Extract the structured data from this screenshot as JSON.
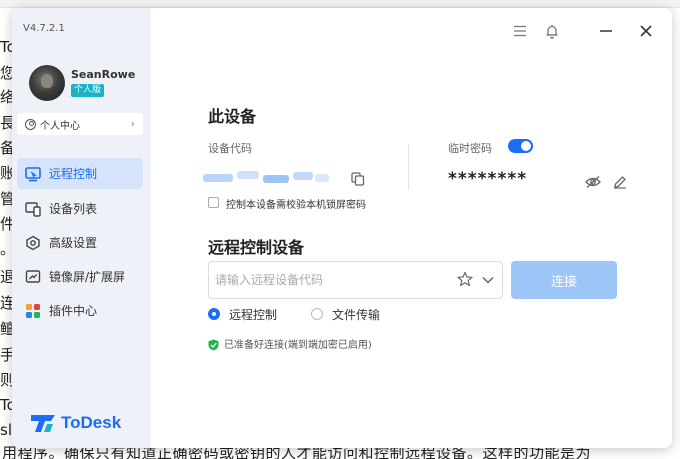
{
  "background_doc": {
    "left_chars": [
      "To",
      "您",
      "络",
      "長",
      "备",
      "账",
      "管",
      "件",
      "。",
      "退",
      "连",
      "鳣",
      "手",
      "则",
      "To",
      "sl"
    ],
    "bottom_line": "用程序。确保只有知道正确密码或密钥的人才能访问和控制远程设备。这样的功能是为"
  },
  "app": {
    "version": "V4.7.2.1",
    "user": {
      "name": "SeanRowe",
      "badge": "个人版"
    },
    "profile_center": "个人中心",
    "nav": [
      {
        "label": "远程控制",
        "icon": "remote-control-icon",
        "active": true
      },
      {
        "label": "设备列表",
        "icon": "device-list-icon",
        "active": false
      },
      {
        "label": "高级设置",
        "icon": "advanced-settings-icon",
        "active": false
      },
      {
        "label": "镜像屏/扩展屏",
        "icon": "mirror-screen-icon",
        "active": false
      },
      {
        "label": "插件中心",
        "icon": "plugin-center-icon",
        "active": false
      }
    ],
    "logo_text": "ToDesk"
  },
  "device": {
    "title": "此设备",
    "code_label": "设备代码",
    "temp_password_label": "临时密码",
    "temp_password_enabled": true,
    "password": "********",
    "lock_checkbox_label": "控制本设备需校验本机锁屏密码",
    "lock_checkbox_checked": false
  },
  "remote": {
    "title": "远程控制设备",
    "input_placeholder": "请输入远程设备代码",
    "connect_label": "连接",
    "modes": [
      {
        "label": "远程控制",
        "selected": true
      },
      {
        "label": "文件传输",
        "selected": false
      }
    ],
    "status": "已准备好连接(端到端加密已启用)"
  },
  "colors": {
    "accent": "#1a6ef5",
    "sidebar_bg": "#eef1f7",
    "active_nav_bg": "#d5e3fb",
    "connect_disabled": "#9dc5f8",
    "status_green": "#21b34a",
    "badge_teal": "#18b4c6"
  }
}
